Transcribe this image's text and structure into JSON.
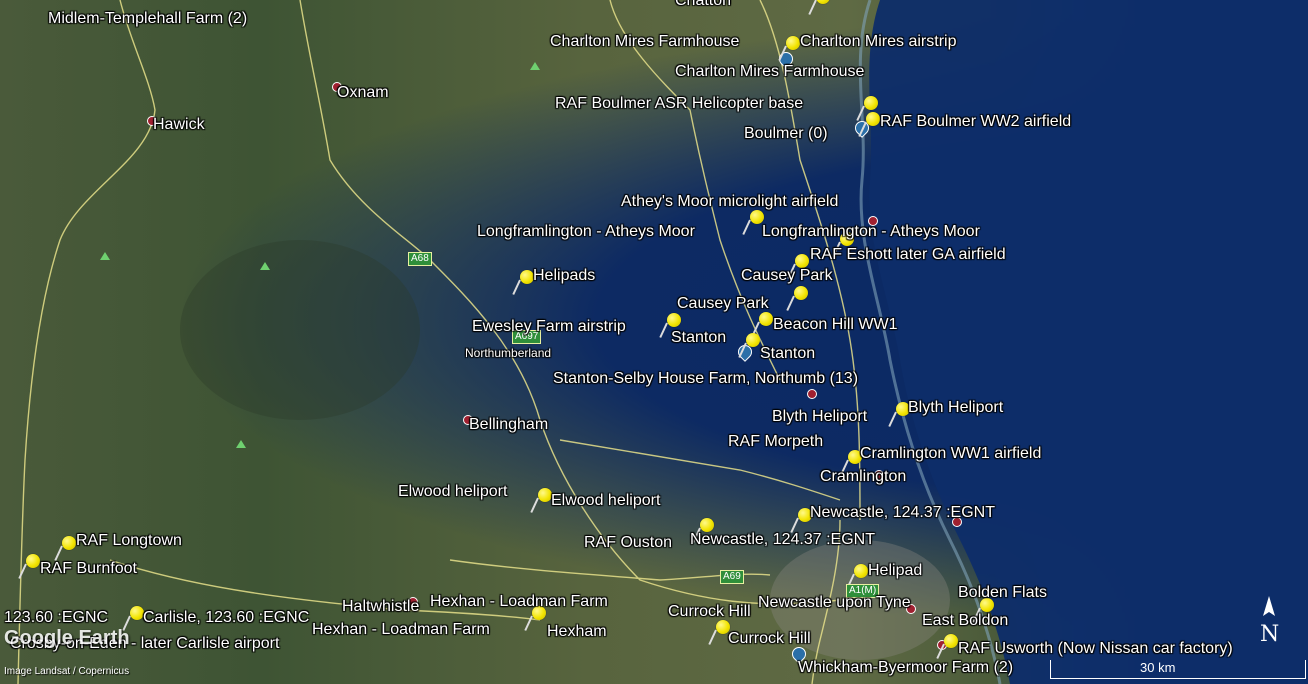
{
  "map": {
    "labels": [
      {
        "text": "Midlem-Templehall Farm (2)"
      },
      {
        "text": "Chatton"
      },
      {
        "text": "Charlton Mires Farmhouse"
      },
      {
        "text": "Charlton Mires airstrip"
      },
      {
        "text": "Charlton Mires Farmhouse"
      },
      {
        "text": "Oxnam"
      },
      {
        "text": "RAF Boulmer ASR Helicopter base"
      },
      {
        "text": "Hawick"
      },
      {
        "text": "Boulmer  (0)"
      },
      {
        "text": "RAF Boulmer WW2 airfield"
      },
      {
        "text": "Athey's Moor microlight airfield"
      },
      {
        "text": "Longframlington - Atheys Moor"
      },
      {
        "text": "Longframlington - Atheys Moor"
      },
      {
        "text": "RAF Eshott later GA airfield"
      },
      {
        "text": "Helipads"
      },
      {
        "text": "Causey Park"
      },
      {
        "text": "Causey Park"
      },
      {
        "text": "Ewesley Farm airstrip"
      },
      {
        "text": "Beacon Hill WW1"
      },
      {
        "text": "Stanton"
      },
      {
        "text": "Stanton"
      },
      {
        "text": "Northumberland"
      },
      {
        "text": "Stanton-Selby House Farm, Northumb (13)"
      },
      {
        "text": "Blyth Heliport"
      },
      {
        "text": "Blyth Heliport"
      },
      {
        "text": "Bellingham"
      },
      {
        "text": "RAF Morpeth"
      },
      {
        "text": "Cramlington WW1 airfield"
      },
      {
        "text": "Cramlington"
      },
      {
        "text": "Elwood heliport"
      },
      {
        "text": "Elwood heliport"
      },
      {
        "text": "Newcastle, 124.37 :EGNT"
      },
      {
        "text": "RAF Ouston"
      },
      {
        "text": "Newcastle, 124.37 :EGNT"
      },
      {
        "text": "RAF Longtown"
      },
      {
        "text": "RAF Burnfoot"
      },
      {
        "text": "Helipad"
      },
      {
        "text": "Bolden Flats"
      },
      {
        "text": "Newcastle upon Tyne"
      },
      {
        "text": "123.60 :EGNC"
      },
      {
        "text": "Carlisle, 123.60 :EGNC"
      },
      {
        "text": "Haltwhistle"
      },
      {
        "text": "Hexhan - Loadman Farm"
      },
      {
        "text": "Currock Hill"
      },
      {
        "text": "East Boldon"
      },
      {
        "text": "Hexhan - Loadman Farm"
      },
      {
        "text": "Hexham"
      },
      {
        "text": "Currock Hill"
      },
      {
        "text": "RAF Usworth  (Now Nissan car factory)"
      },
      {
        "text": "Crosby-on-Eden - later Carlisle airport"
      },
      {
        "text": "Whickham-Byermoor Farm (2)"
      }
    ],
    "road_signs": [
      "A68",
      "A697",
      "A69",
      "A1(M)"
    ],
    "branding": {
      "logo": "Google Earth",
      "credit": "Image Landsat / Copernicus"
    },
    "scale_text": "30 km",
    "north_letter": "N"
  }
}
